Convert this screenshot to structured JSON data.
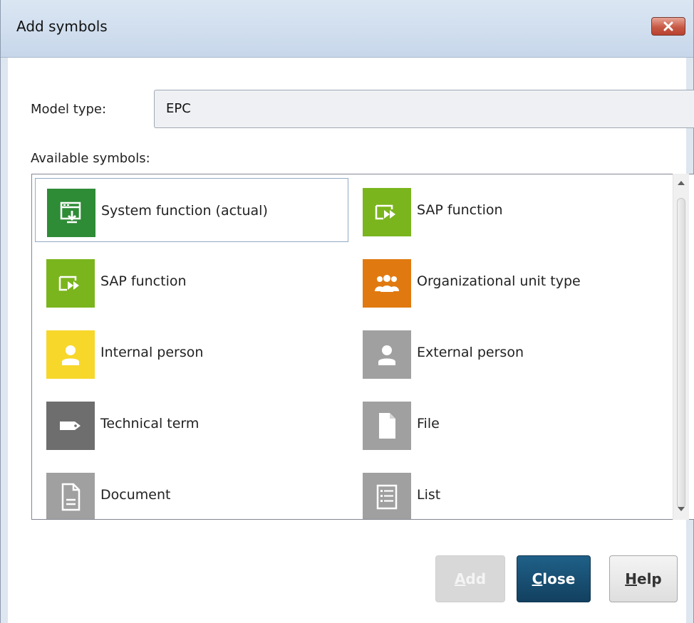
{
  "window": {
    "title": "Add symbols"
  },
  "model_type": {
    "label": "Model type:",
    "value": "EPC"
  },
  "symbols": {
    "label": "Available symbols:",
    "items": [
      {
        "label": "System function (actual)",
        "icon": "system-function-icon",
        "color": "#2e8b36"
      },
      {
        "label": "SAP function",
        "icon": "sap-function-icon",
        "color": "#7ab51d"
      },
      {
        "label": "SAP function",
        "icon": "sap-function-icon",
        "color": "#7ab51d"
      },
      {
        "label": "Organizational unit type",
        "icon": "organizational-unit-icon",
        "color": "#e07a10"
      },
      {
        "label": "Internal person",
        "icon": "person-icon",
        "color": "#f7d72a"
      },
      {
        "label": "External person",
        "icon": "person-icon",
        "color": "#a0a0a0"
      },
      {
        "label": "Technical term",
        "icon": "tag-icon",
        "color": "#6e6e6e"
      },
      {
        "label": "File",
        "icon": "file-icon",
        "color": "#a0a0a0"
      },
      {
        "label": "Document",
        "icon": "document-icon",
        "color": "#a0a0a0"
      },
      {
        "label": "List",
        "icon": "list-icon",
        "color": "#a0a0a0"
      }
    ]
  },
  "buttons": {
    "add_first": "A",
    "add_rest": "dd",
    "close_first": "C",
    "close_rest": "lose",
    "help_first": "H",
    "help_rest": "elp"
  }
}
